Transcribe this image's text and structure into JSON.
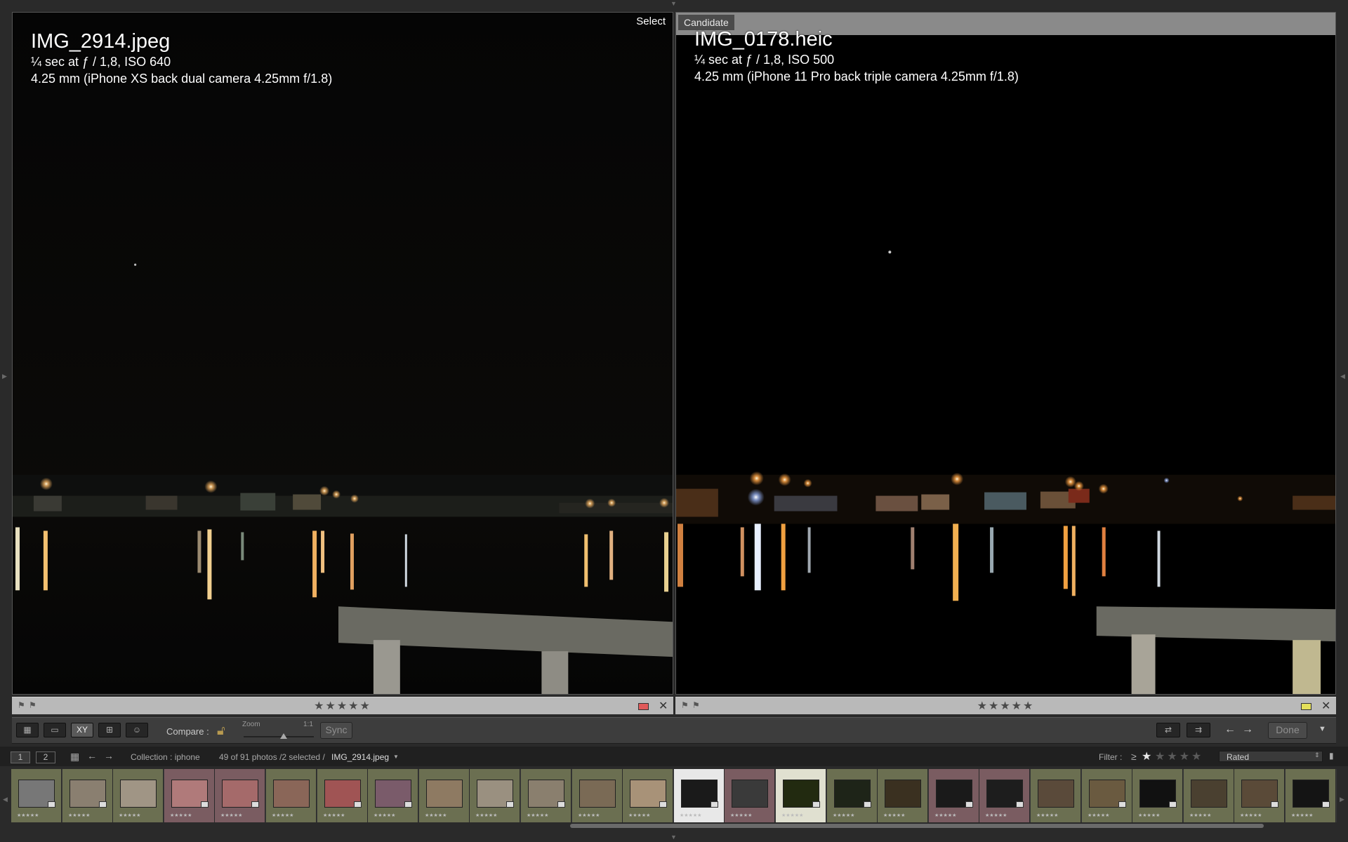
{
  "left_pane": {
    "role_label": "Select",
    "filename": "IMG_2914.jpeg",
    "exposure": "¼ sec at ƒ / 1,8, ISO 640",
    "lens": "4.25 mm (iPhone XS back dual camera 4.25mm f/1.8)",
    "stars": "★★★★★",
    "color_label": "#e05a5a"
  },
  "right_pane": {
    "role_label": "Candidate",
    "filename": "IMG_0178.heic",
    "exposure": "¼ sec at ƒ / 1,8, ISO 500",
    "lens": "4.25 mm (iPhone 11 Pro back triple camera 4.25mm f/1.8)",
    "stars": "★★★★★",
    "color_label": "#e4e05a"
  },
  "toolbar": {
    "compare_label": "Compare :",
    "zoom_label": "Zoom",
    "zoom_max": "1:1",
    "sync_label": "Sync",
    "done_label": "Done",
    "view_xy_label": "XY"
  },
  "filmstrip_header": {
    "screen1": "1",
    "screen2": "2",
    "collection": "Collection : iphone",
    "count": "49 of 91 photos /2 selected /",
    "current_file": "IMG_2914.jpeg",
    "filter_label": "Filter :",
    "filter_op": "≥",
    "rated_value": "Rated"
  },
  "filmstrip": {
    "thumb_stars": "★★★★★",
    "cells": [
      {
        "tone": "#6b6f51",
        "thumb": "#777"
      },
      {
        "tone": "#6b6f51",
        "thumb": "#8a7f70"
      },
      {
        "tone": "#6b6f51",
        "thumb": "#a09585"
      },
      {
        "tone": "#7a5c61",
        "thumb": "#b07a7a"
      },
      {
        "tone": "#7a5c61",
        "thumb": "#a56a6a"
      },
      {
        "tone": "#6b6f51",
        "thumb": "#8a6658"
      },
      {
        "tone": "#6b6f51",
        "thumb": "#a05454"
      },
      {
        "tone": "#6b6f51",
        "thumb": "#7a5b6a"
      },
      {
        "tone": "#6b6f51",
        "thumb": "#8e7a62"
      },
      {
        "tone": "#6b6f51",
        "thumb": "#9a9080"
      },
      {
        "tone": "#6b6f51",
        "thumb": "#8a7f6e"
      },
      {
        "tone": "#6b6f51",
        "thumb": "#7a6a55"
      },
      {
        "tone": "#6b6f51",
        "thumb": "#a89278"
      },
      {
        "tone": "#e8e8e8",
        "thumb": "#1a1a1a"
      },
      {
        "tone": "#7a5c61",
        "thumb": "#3a3a3a"
      },
      {
        "tone": "#e0e0d0",
        "thumb": "#222a10"
      },
      {
        "tone": "#6b6f51",
        "thumb": "#1e2418"
      },
      {
        "tone": "#6b6f51",
        "thumb": "#3a3020"
      },
      {
        "tone": "#7a5c61",
        "thumb": "#1a1a1a"
      },
      {
        "tone": "#7a5c61",
        "thumb": "#1d1d1d"
      },
      {
        "tone": "#6b6f51",
        "thumb": "#5a4a3a"
      },
      {
        "tone": "#6b6f51",
        "thumb": "#6a5a40"
      },
      {
        "tone": "#6b6f51",
        "thumb": "#111"
      },
      {
        "tone": "#6b6f51",
        "thumb": "#4a4030"
      },
      {
        "tone": "#6b6f51",
        "thumb": "#5a4a38"
      },
      {
        "tone": "#6b6f51",
        "thumb": "#141414"
      }
    ]
  }
}
